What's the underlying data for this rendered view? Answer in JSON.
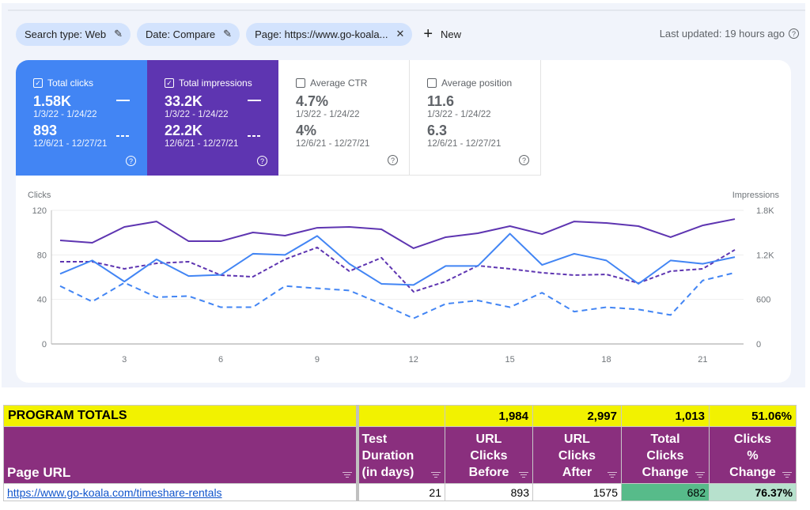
{
  "filters": {
    "chips": [
      {
        "label": "Search type: Web",
        "icon": "pencil-icon"
      },
      {
        "label": "Date: Compare",
        "icon": "pencil-icon"
      },
      {
        "label": "Page: https://www.go-koala...",
        "icon": "close-icon"
      }
    ],
    "new_label": "New",
    "last_updated": "Last updated: 19 hours ago"
  },
  "cards": [
    {
      "label": "Total clicks",
      "checked": true,
      "current": "1.58K",
      "current_range": "1/3/22 - 1/24/22",
      "previous": "893",
      "previous_range": "12/6/21 - 12/27/21"
    },
    {
      "label": "Total impressions",
      "checked": true,
      "current": "33.2K",
      "current_range": "1/3/22 - 1/24/22",
      "previous": "22.2K",
      "previous_range": "12/6/21 - 12/27/21"
    },
    {
      "label": "Average CTR",
      "checked": false,
      "current": "4.7%",
      "current_range": "1/3/22 - 1/24/22",
      "previous": "4%",
      "previous_range": "12/6/21 - 12/27/21"
    },
    {
      "label": "Average position",
      "checked": false,
      "current": "11.6",
      "current_range": "1/3/22 - 1/24/22",
      "previous": "6.3",
      "previous_range": "12/6/21 - 12/27/21"
    }
  ],
  "colors": {
    "clicks": "#4285f4",
    "impressions": "#5e35b1",
    "totals_bg": "#f2f200",
    "header_bg": "#8a2f7e",
    "change_green": "#57bb8a",
    "pct_green": "#b7e1cd"
  },
  "chart_data": {
    "type": "line",
    "ylabel": "Clicks",
    "y2label": "Impressions",
    "ylim": [
      0,
      120
    ],
    "y2lim": [
      0,
      1800
    ],
    "yticks": [
      "0",
      "40",
      "80",
      "120"
    ],
    "y2ticks": [
      "0",
      "600",
      "1.2K",
      "1.8K"
    ],
    "xticks": [
      "3",
      "6",
      "9",
      "12",
      "15",
      "18",
      "21"
    ],
    "x": [
      1,
      2,
      3,
      4,
      5,
      6,
      7,
      8,
      9,
      10,
      11,
      12,
      13,
      14,
      15,
      16,
      17,
      18,
      19,
      20,
      21,
      22
    ],
    "grid": true,
    "series": [
      {
        "name": "Clicks (1/3/22 - 1/24/22)",
        "axis": "left",
        "style": "solid",
        "color": "#4285f4",
        "values": [
          63,
          75,
          56,
          76,
          61,
          62,
          81,
          80,
          97,
          72,
          54,
          53,
          70,
          70,
          99,
          71,
          81,
          75,
          54,
          75,
          72,
          78
        ]
      },
      {
        "name": "Clicks (12/6/21 - 12/27/21)",
        "axis": "left",
        "style": "dashed",
        "color": "#4285f4",
        "values": [
          52,
          38,
          55,
          42,
          43,
          33,
          33,
          52,
          50,
          48,
          36,
          23,
          36,
          39,
          33,
          46,
          29,
          33,
          31,
          26,
          57,
          64
        ]
      },
      {
        "name": "Impressions (1/3/22 - 1/24/22)",
        "axis": "right",
        "style": "solid",
        "color": "#5e35b1",
        "values": [
          1395,
          1363,
          1576,
          1650,
          1384,
          1384,
          1502,
          1459,
          1565,
          1576,
          1544,
          1289,
          1438,
          1491,
          1587,
          1480,
          1650,
          1629,
          1587,
          1438,
          1597,
          1682
        ]
      },
      {
        "name": "Impressions (12/6/21 - 12/27/21)",
        "axis": "right",
        "style": "dashed",
        "color": "#5e35b1",
        "values": [
          1108,
          1108,
          1012,
          1086,
          1108,
          927,
          905,
          1140,
          1300,
          980,
          1161,
          703,
          842,
          1054,
          1012,
          959,
          927,
          937,
          820,
          980,
          1012,
          1268
        ]
      }
    ]
  },
  "sheet": {
    "totals_label": "PROGRAM TOTALS",
    "totals": [
      "",
      "1,984",
      "2,997",
      "1,013",
      "51.06%"
    ],
    "headers": [
      "Page URL",
      "Test Duration (in days)",
      "URL Clicks Before",
      "URL Clicks After",
      "Total Clicks Change",
      "Clicks % Change"
    ],
    "rows": [
      {
        "url": "https://www.go-koala.com/timeshare-rentals",
        "duration": "21",
        "before": "893",
        "after": "1575",
        "change": "682",
        "pct": "76.37%"
      }
    ]
  }
}
